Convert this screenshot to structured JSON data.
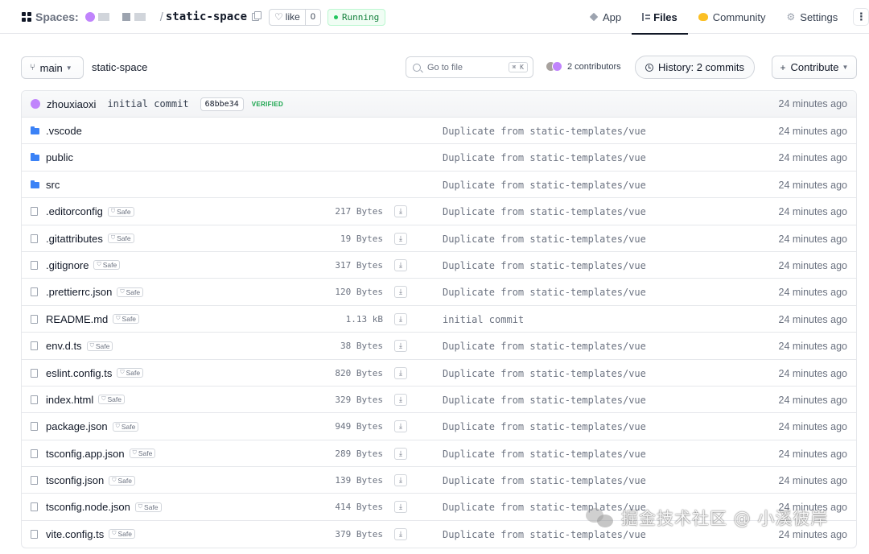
{
  "header": {
    "spaces_label": "Spaces:",
    "repo_name": "static-space",
    "like_label": "like",
    "like_count": "0",
    "status": "Running",
    "nav": [
      {
        "label": "App",
        "icon": "app-icon"
      },
      {
        "label": "Files",
        "icon": "files-icon",
        "active": true
      },
      {
        "label": "Community",
        "icon": "community-icon"
      },
      {
        "label": "Settings",
        "icon": "gear-icon"
      }
    ],
    "more_label": "⋮"
  },
  "toolbar": {
    "branch": "main",
    "path": "static-space",
    "search_placeholder": "Go to file",
    "search_shortcut": "⌘ K",
    "contributors": "2 contributors",
    "history": "History: 2 commits",
    "contribute": "Contribute"
  },
  "commit": {
    "author": "zhouxiaoxi",
    "message": "initial commit",
    "hash": "68bbe34",
    "verified": "VERIFIED",
    "time": "24 minutes ago"
  },
  "safe_label": "Safe",
  "files": [
    {
      "type": "folder",
      "name": ".vscode",
      "size": "",
      "message": "Duplicate from static-templates/vue",
      "time": "24 minutes ago"
    },
    {
      "type": "folder",
      "name": "public",
      "size": "",
      "message": "Duplicate from static-templates/vue",
      "time": "24 minutes ago"
    },
    {
      "type": "folder",
      "name": "src",
      "size": "",
      "message": "Duplicate from static-templates/vue",
      "time": "24 minutes ago"
    },
    {
      "type": "file",
      "name": ".editorconfig",
      "size": "217 Bytes",
      "message": "Duplicate from static-templates/vue",
      "time": "24 minutes ago"
    },
    {
      "type": "file",
      "name": ".gitattributes",
      "size": "19 Bytes",
      "message": "Duplicate from static-templates/vue",
      "time": "24 minutes ago"
    },
    {
      "type": "file",
      "name": ".gitignore",
      "size": "317 Bytes",
      "message": "Duplicate from static-templates/vue",
      "time": "24 minutes ago"
    },
    {
      "type": "file",
      "name": ".prettierrc.json",
      "size": "120 Bytes",
      "message": "Duplicate from static-templates/vue",
      "time": "24 minutes ago"
    },
    {
      "type": "file",
      "name": "README.md",
      "size": "1.13 kB",
      "message": "initial commit",
      "time": "24 minutes ago"
    },
    {
      "type": "file",
      "name": "env.d.ts",
      "size": "38 Bytes",
      "message": "Duplicate from static-templates/vue",
      "time": "24 minutes ago"
    },
    {
      "type": "file",
      "name": "eslint.config.ts",
      "size": "820 Bytes",
      "message": "Duplicate from static-templates/vue",
      "time": "24 minutes ago"
    },
    {
      "type": "file",
      "name": "index.html",
      "size": "329 Bytes",
      "message": "Duplicate from static-templates/vue",
      "time": "24 minutes ago"
    },
    {
      "type": "file",
      "name": "package.json",
      "size": "949 Bytes",
      "message": "Duplicate from static-templates/vue",
      "time": "24 minutes ago"
    },
    {
      "type": "file",
      "name": "tsconfig.app.json",
      "size": "289 Bytes",
      "message": "Duplicate from static-templates/vue",
      "time": "24 minutes ago"
    },
    {
      "type": "file",
      "name": "tsconfig.json",
      "size": "139 Bytes",
      "message": "Duplicate from static-templates/vue",
      "time": "24 minutes ago"
    },
    {
      "type": "file",
      "name": "tsconfig.node.json",
      "size": "414 Bytes",
      "message": "Duplicate from static-templates/vue",
      "time": "24 minutes ago"
    },
    {
      "type": "file",
      "name": "vite.config.ts",
      "size": "379 Bytes",
      "message": "Duplicate from static-templates/vue",
      "time": "24 minutes ago"
    }
  ],
  "watermark": "掘金技术社区 @ 小溪彼岸"
}
